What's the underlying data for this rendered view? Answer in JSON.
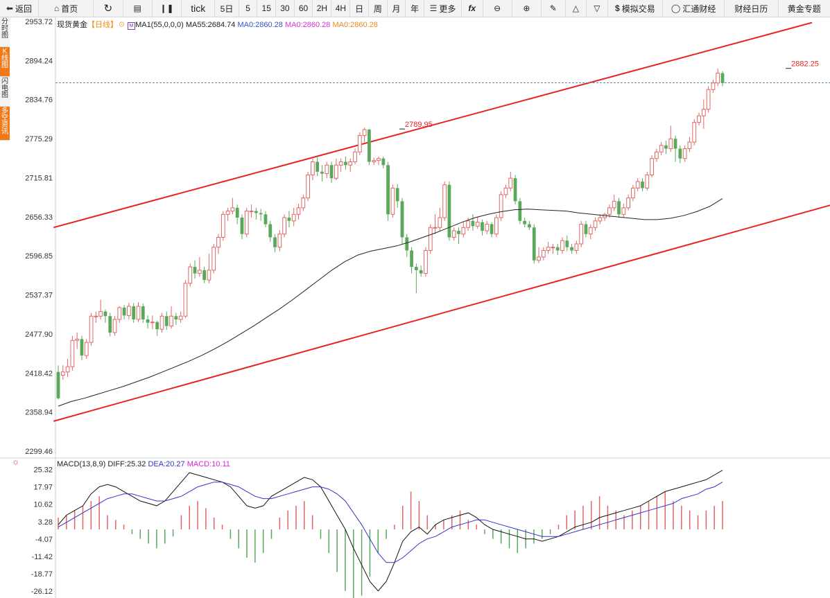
{
  "toolbar": {
    "back": "返回",
    "home": "首页",
    "tick": "tick",
    "periods": [
      "5日",
      "5",
      "15",
      "30",
      "60",
      "2H",
      "4H",
      "日",
      "周",
      "月",
      "年"
    ],
    "more": "更多",
    "sim_trade": "模拟交易",
    "huitong": "汇通财经",
    "calendar": "财经日历",
    "gold": "黄金专题"
  },
  "sidebar": [
    "分时图",
    "K线图",
    "闪电图",
    "多空资讯"
  ],
  "legend": {
    "name": "现货黄金",
    "period": "【日线】",
    "ma1": "MA1(55,0,0,0)",
    "ma55": "MA55:2684.74",
    "ma0a": "MA0:2860.28",
    "ma0b": "MA0:2860.28",
    "ma0c": "MA0:2860.28"
  },
  "macd_legend": {
    "label": "MACD(13,8,9)",
    "diff": "DIFF:25.32",
    "dea": "DEA:20.27",
    "macd": "MACD:10.11"
  },
  "colors": {
    "up": "#e06666",
    "down": "#5aa85a",
    "channel": "#e8231f",
    "ma": "#222222",
    "dea": "#3333cc",
    "macd_label": "#e020e0",
    "ma0c": "#f08a1a",
    "ma0b": "#dd33dd",
    "ma0a": "#3355cc"
  },
  "chart_data": [
    {
      "type": "candlestick",
      "title": "现货黄金 日线",
      "ylim": [
        2290,
        2960
      ],
      "y_ticks": [
        "2953.72",
        "2894.24",
        "2834.76",
        "2775.29",
        "2715.81",
        "2656.33",
        "2596.85",
        "2537.37",
        "2477.90",
        "2418.42",
        "2358.94",
        "2299.46"
      ],
      "current_price": 2860.28,
      "annotations": [
        {
          "text": "2882.25",
          "value": 2882.25,
          "index": 155
        },
        {
          "text": "2789.95",
          "value": 2789.95,
          "index": 73
        }
      ],
      "candles": [
        [
          2420,
          2380,
          2430,
          2378
        ],
        [
          2415,
          2420,
          2430,
          2408
        ],
        [
          2420,
          2428,
          2440,
          2412
        ],
        [
          2428,
          2468,
          2475,
          2422
        ],
        [
          2468,
          2470,
          2480,
          2455
        ],
        [
          2470,
          2445,
          2475,
          2438
        ],
        [
          2445,
          2465,
          2470,
          2440
        ],
        [
          2465,
          2505,
          2510,
          2460
        ],
        [
          2505,
          2505,
          2512,
          2495
        ],
        [
          2505,
          2512,
          2530,
          2500
        ],
        [
          2512,
          2505,
          2515,
          2495
        ],
        [
          2505,
          2480,
          2510,
          2474
        ],
        [
          2480,
          2500,
          2505,
          2475
        ],
        [
          2500,
          2518,
          2520,
          2495
        ],
        [
          2518,
          2506,
          2522,
          2500
        ],
        [
          2506,
          2520,
          2525,
          2500
        ],
        [
          2520,
          2500,
          2525,
          2495
        ],
        [
          2500,
          2520,
          2526,
          2496
        ],
        [
          2520,
          2500,
          2524,
          2495
        ],
        [
          2500,
          2495,
          2506,
          2486
        ],
        [
          2495,
          2496,
          2506,
          2485
        ],
        [
          2496,
          2485,
          2498,
          2475
        ],
        [
          2485,
          2505,
          2510,
          2480
        ],
        [
          2505,
          2490,
          2512,
          2484
        ],
        [
          2490,
          2505,
          2520,
          2486
        ],
        [
          2505,
          2500,
          2510,
          2492
        ],
        [
          2500,
          2505,
          2512,
          2495
        ],
        [
          2505,
          2555,
          2560,
          2502
        ],
        [
          2555,
          2580,
          2585,
          2550
        ],
        [
          2580,
          2570,
          2590,
          2562
        ],
        [
          2570,
          2575,
          2595,
          2565
        ],
        [
          2575,
          2560,
          2580,
          2555
        ],
        [
          2560,
          2575,
          2600,
          2555
        ],
        [
          2575,
          2610,
          2615,
          2570
        ],
        [
          2610,
          2625,
          2630,
          2600
        ],
        [
          2625,
          2660,
          2665,
          2620
        ],
        [
          2660,
          2665,
          2670,
          2650
        ],
        [
          2665,
          2670,
          2685,
          2660
        ],
        [
          2670,
          2655,
          2675,
          2645
        ],
        [
          2655,
          2630,
          2660,
          2622
        ],
        [
          2630,
          2665,
          2670,
          2625
        ],
        [
          2665,
          2665,
          2675,
          2655
        ],
        [
          2665,
          2662,
          2670,
          2652
        ],
        [
          2662,
          2660,
          2668,
          2650
        ],
        [
          2660,
          2645,
          2665,
          2640
        ],
        [
          2645,
          2625,
          2650,
          2618
        ],
        [
          2625,
          2610,
          2630,
          2602
        ],
        [
          2610,
          2630,
          2636,
          2604
        ],
        [
          2630,
          2655,
          2660,
          2625
        ],
        [
          2655,
          2650,
          2665,
          2640
        ],
        [
          2650,
          2660,
          2670,
          2642
        ],
        [
          2660,
          2670,
          2676,
          2652
        ],
        [
          2670,
          2685,
          2690,
          2665
        ],
        [
          2685,
          2720,
          2725,
          2680
        ],
        [
          2720,
          2740,
          2745,
          2712
        ],
        [
          2740,
          2725,
          2750,
          2718
        ],
        [
          2725,
          2722,
          2735,
          2710
        ],
        [
          2722,
          2735,
          2740,
          2715
        ],
        [
          2735,
          2715,
          2740,
          2708
        ],
        [
          2715,
          2735,
          2745,
          2712
        ],
        [
          2735,
          2740,
          2745,
          2725
        ],
        [
          2740,
          2735,
          2748,
          2728
        ],
        [
          2735,
          2740,
          2745,
          2725
        ],
        [
          2740,
          2755,
          2760,
          2736
        ],
        [
          2755,
          2780,
          2785,
          2750
        ],
        [
          2780,
          2789,
          2792,
          2770
        ],
        [
          2789,
          2740,
          2790,
          2735
        ],
        [
          2740,
          2742,
          2746,
          2735
        ],
        [
          2742,
          2745,
          2748,
          2735
        ],
        [
          2745,
          2735,
          2748,
          2730
        ],
        [
          2735,
          2660,
          2740,
          2650
        ],
        [
          2660,
          2700,
          2705,
          2655
        ],
        [
          2700,
          2680,
          2706,
          2670
        ],
        [
          2680,
          2625,
          2685,
          2615
        ],
        [
          2625,
          2605,
          2630,
          2595
        ],
        [
          2605,
          2580,
          2610,
          2570
        ],
        [
          2580,
          2575,
          2585,
          2540
        ],
        [
          2575,
          2570,
          2582,
          2565
        ],
        [
          2570,
          2605,
          2610,
          2565
        ],
        [
          2605,
          2640,
          2645,
          2600
        ],
        [
          2640,
          2640,
          2660,
          2630
        ],
        [
          2640,
          2655,
          2670,
          2635
        ],
        [
          2655,
          2705,
          2710,
          2650
        ],
        [
          2705,
          2625,
          2710,
          2620
        ],
        [
          2625,
          2635,
          2640,
          2620
        ],
        [
          2635,
          2630,
          2640,
          2615
        ],
        [
          2630,
          2640,
          2648,
          2625
        ],
        [
          2640,
          2650,
          2655,
          2635
        ],
        [
          2650,
          2642,
          2660,
          2635
        ],
        [
          2642,
          2648,
          2656,
          2638
        ],
        [
          2648,
          2635,
          2652,
          2628
        ],
        [
          2635,
          2645,
          2650,
          2630
        ],
        [
          2645,
          2630,
          2648,
          2625
        ],
        [
          2630,
          2655,
          2660,
          2625
        ],
        [
          2655,
          2690,
          2695,
          2650
        ],
        [
          2690,
          2700,
          2705,
          2685
        ],
        [
          2700,
          2715,
          2725,
          2695
        ],
        [
          2715,
          2680,
          2720,
          2675
        ],
        [
          2680,
          2650,
          2685,
          2645
        ],
        [
          2650,
          2645,
          2655,
          2640
        ],
        [
          2645,
          2640,
          2650,
          2636
        ],
        [
          2640,
          2590,
          2645,
          2585
        ],
        [
          2590,
          2595,
          2610,
          2586
        ],
        [
          2595,
          2605,
          2610,
          2590
        ],
        [
          2605,
          2610,
          2618,
          2600
        ],
        [
          2610,
          2610,
          2615,
          2600
        ],
        [
          2610,
          2605,
          2615,
          2598
        ],
        [
          2605,
          2620,
          2625,
          2600
        ],
        [
          2620,
          2610,
          2628,
          2604
        ],
        [
          2610,
          2605,
          2615,
          2600
        ],
        [
          2605,
          2615,
          2620,
          2600
        ],
        [
          2615,
          2645,
          2650,
          2610
        ],
        [
          2645,
          2630,
          2650,
          2625
        ],
        [
          2630,
          2640,
          2645,
          2622
        ],
        [
          2640,
          2650,
          2655,
          2635
        ],
        [
          2650,
          2655,
          2660,
          2645
        ],
        [
          2655,
          2660,
          2662,
          2650
        ],
        [
          2660,
          2670,
          2675,
          2655
        ],
        [
          2670,
          2680,
          2690,
          2665
        ],
        [
          2680,
          2660,
          2685,
          2655
        ],
        [
          2660,
          2670,
          2676,
          2655
        ],
        [
          2670,
          2685,
          2690,
          2666
        ],
        [
          2685,
          2700,
          2705,
          2680
        ],
        [
          2700,
          2710,
          2715,
          2695
        ],
        [
          2710,
          2700,
          2715,
          2695
        ],
        [
          2700,
          2720,
          2725,
          2696
        ],
        [
          2720,
          2745,
          2750,
          2716
        ],
        [
          2745,
          2755,
          2760,
          2740
        ],
        [
          2755,
          2765,
          2770,
          2750
        ],
        [
          2765,
          2760,
          2772,
          2752
        ],
        [
          2760,
          2775,
          2795,
          2755
        ],
        [
          2775,
          2760,
          2780,
          2740
        ],
        [
          2760,
          2745,
          2765,
          2738
        ],
        [
          2745,
          2760,
          2765,
          2740
        ],
        [
          2760,
          2770,
          2778,
          2755
        ],
        [
          2770,
          2800,
          2805,
          2765
        ],
        [
          2800,
          2810,
          2815,
          2795
        ],
        [
          2810,
          2820,
          2835,
          2790
        ],
        [
          2820,
          2850,
          2855,
          2815
        ],
        [
          2850,
          2860,
          2865,
          2845
        ],
        [
          2860,
          2875,
          2882,
          2855
        ],
        [
          2875,
          2860,
          2878,
          2855
        ]
      ]
    },
    {
      "type": "line",
      "series": [
        {
          "name": "MA55"
        }
      ],
      "values": [
        2368,
        2375,
        2380,
        2386,
        2392,
        2398,
        2405,
        2412,
        2420,
        2428,
        2436,
        2445,
        2455,
        2466,
        2478,
        2490,
        2503,
        2516,
        2530,
        2545,
        2560,
        2575,
        2588,
        2598,
        2604,
        2608,
        2612,
        2618,
        2625,
        2632,
        2640,
        2648,
        2655,
        2660,
        2664,
        2667,
        2668,
        2667,
        2666,
        2665,
        2662,
        2660,
        2658,
        2656,
        2654,
        2652,
        2652,
        2654,
        2658,
        2664,
        2672,
        2684
      ]
    },
    {
      "type": "bar",
      "title": "MACD(13,8,9)",
      "ylim": [
        -29,
        29
      ],
      "y_ticks": [
        "25.32",
        "17.97",
        "10.62",
        "3.28",
        "-4.07",
        "-11.42",
        "-18.77",
        "-26.12"
      ],
      "series": [
        {
          "name": "DIFF",
          "values": [
            2,
            6,
            8,
            10,
            15,
            18,
            19,
            18,
            16,
            14,
            12,
            11,
            10,
            12,
            16,
            20,
            24,
            23,
            22,
            21,
            20,
            18,
            14,
            10,
            9,
            10,
            14,
            16,
            18,
            20,
            22,
            21,
            18,
            12,
            6,
            0,
            -8,
            -15,
            -22,
            -26,
            -22,
            -14,
            -5,
            -1,
            1,
            -2,
            2,
            4,
            5,
            6,
            7,
            5,
            2,
            0,
            -1,
            -2,
            -3,
            -4,
            -4,
            -5,
            -4,
            -3,
            -1,
            1,
            2,
            3,
            5,
            6,
            7,
            8,
            9,
            10,
            12,
            14,
            16,
            17,
            18,
            19,
            20,
            21,
            23,
            25
          ]
        },
        {
          "name": "DEA",
          "values": [
            1,
            3,
            5,
            7,
            9,
            11,
            13,
            14,
            15,
            15,
            14,
            13,
            12,
            12,
            13,
            14,
            16,
            18,
            19,
            20,
            20,
            19,
            18,
            16,
            14,
            13,
            13,
            14,
            15,
            16,
            17,
            18,
            18,
            17,
            15,
            12,
            7,
            2,
            -4,
            -10,
            -14,
            -14,
            -12,
            -9,
            -6,
            -4,
            -3,
            -1,
            1,
            2,
            3,
            4,
            4,
            3,
            2,
            1,
            0,
            -1,
            -2,
            -3,
            -3,
            -3,
            -2,
            -1,
            0,
            1,
            2,
            3,
            4,
            5,
            6,
            7,
            8,
            9,
            10,
            11,
            13,
            14,
            15,
            17,
            18,
            20
          ]
        },
        {
          "name": "MACD",
          "values": [
            5,
            6,
            8,
            10,
            12,
            14,
            6,
            4,
            2,
            -2,
            -4,
            -6,
            -8,
            -6,
            -3,
            6,
            10,
            12,
            9,
            5,
            2,
            -4,
            -8,
            -12,
            -14,
            -10,
            -4,
            5,
            8,
            10,
            12,
            6,
            -4,
            -10,
            -18,
            -26,
            -30,
            -28,
            -20,
            -10,
            -4,
            2,
            10,
            16,
            12,
            6,
            2,
            4,
            6,
            8,
            4,
            2,
            -2,
            -4,
            -6,
            -8,
            -10,
            -8,
            -6,
            -4,
            -2,
            2,
            6,
            8,
            10,
            12,
            14,
            10,
            8,
            6,
            8,
            10,
            12,
            14,
            16,
            12,
            10,
            8,
            6,
            8,
            10,
            12
          ]
        }
      ]
    }
  ]
}
